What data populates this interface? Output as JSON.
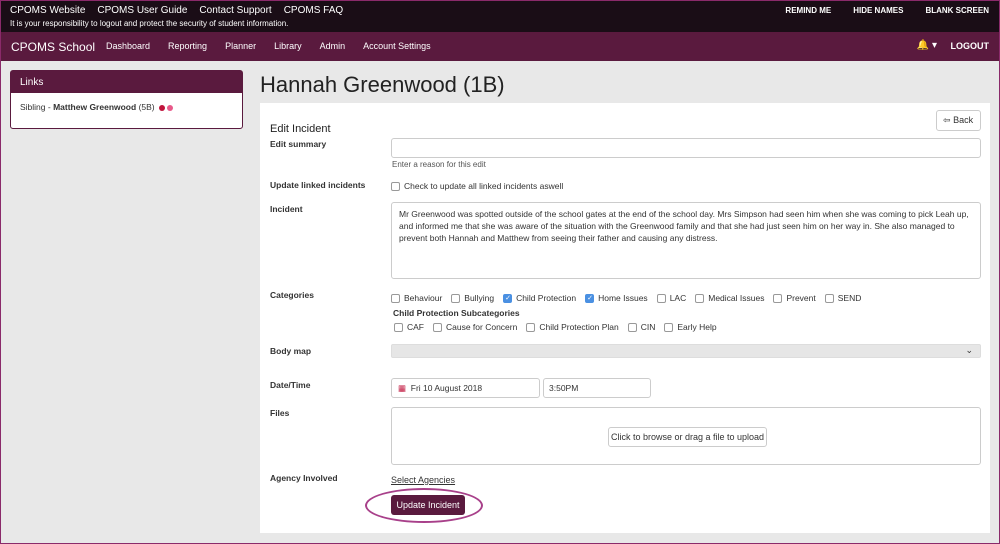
{
  "topbar": {
    "links": [
      "CPOMS Website",
      "CPOMS User Guide",
      "Contact Support",
      "CPOMS FAQ"
    ],
    "notice": "It is your responsibility to logout and protect the security of student information.",
    "right": [
      "REMIND ME",
      "HIDE NAMES",
      "BLANK SCREEN"
    ]
  },
  "navbar": {
    "brand": "CPOMS School",
    "menu": [
      "Dashboard",
      "Reporting",
      "Planner",
      "Library",
      "Admin",
      "Account Settings"
    ],
    "logout": "LOGOUT"
  },
  "links_panel": {
    "title": "Links",
    "item_prefix": "Sibling - ",
    "item_name": "Matthew Greenwood",
    "item_class": " (5B)"
  },
  "page": {
    "title": "Hannah Greenwood (1B)",
    "back": "Back",
    "form_title": "Edit Incident"
  },
  "form": {
    "edit_summary_label": "Edit summary",
    "edit_summary_help": "Enter a reason for this edit",
    "linked_label": "Update linked incidents",
    "linked_text": "Check to update all linked incidents aswell",
    "incident_label": "Incident",
    "incident_text": "Mr Greenwood was spotted outside of the school gates at the end of the school day. Mrs Simpson had seen him when she was coming to pick Leah up, and informed me that she was aware of the situation with the Greenwood family and that she had just seen him on her way in. She also managed to prevent both Hannah and Matthew from seeing their father and causing any distress.",
    "categories_label": "Categories",
    "categories": [
      {
        "label": "Behaviour",
        "checked": false
      },
      {
        "label": "Bullying",
        "checked": false
      },
      {
        "label": "Child Protection",
        "checked": true
      },
      {
        "label": "Home Issues",
        "checked": true
      },
      {
        "label": "LAC",
        "checked": false
      },
      {
        "label": "Medical Issues",
        "checked": false
      },
      {
        "label": "Prevent",
        "checked": false
      },
      {
        "label": "SEND",
        "checked": false
      }
    ],
    "subcat_title": "Child Protection Subcategories",
    "subcategories": [
      {
        "label": "CAF",
        "checked": false
      },
      {
        "label": "Cause for Concern",
        "checked": false
      },
      {
        "label": "Child Protection Plan",
        "checked": false
      },
      {
        "label": "CIN",
        "checked": false
      },
      {
        "label": "Early Help",
        "checked": false
      }
    ],
    "bodymap_label": "Body map",
    "datetime_label": "Date/Time",
    "date_value": "Fri 10 August 2018",
    "time_value": "3:50PM",
    "files_label": "Files",
    "upload_text": "Click to browse or drag a file to upload",
    "agency_label": "Agency Involved",
    "agency_link": "Select Agencies",
    "submit": "Update Incident"
  },
  "colors": {
    "brand": "#5a1a3e",
    "topbar": "#1a0d16",
    "checked": "#4a90e2",
    "highlight": "#a8408a",
    "sibling_dot1": "#c0143c",
    "sibling_dot2": "#e85a8a"
  }
}
